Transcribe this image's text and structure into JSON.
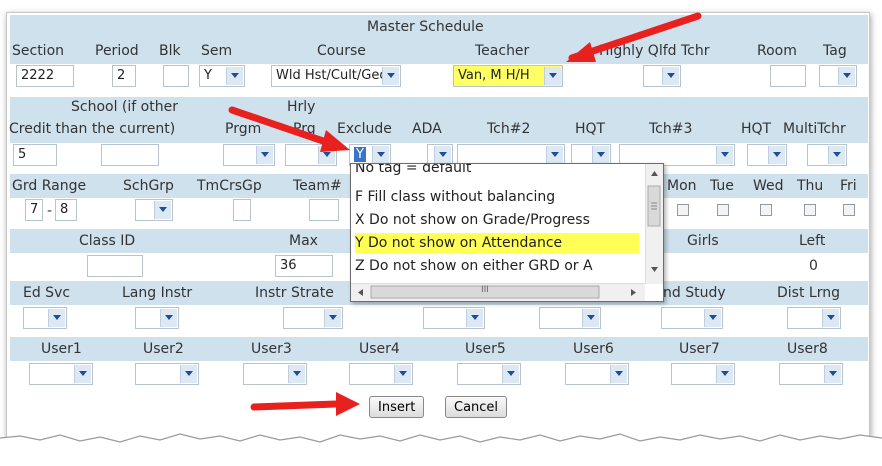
{
  "title": "Master Schedule",
  "row1": {
    "labels": [
      "Section",
      "Period",
      "Blk",
      "Sem",
      "Course",
      "Teacher",
      "Highly Qlfd Tchr",
      "Room",
      "Tag"
    ],
    "section": "2222",
    "period": "2",
    "sem": "Y",
    "course": "Wld Hst/Cult/Geo",
    "teacher": "Van, M  H/H"
  },
  "row2": {
    "school_top": "School (if other",
    "credit_line": "Credit than the current)",
    "prgm": "Prgm",
    "hrly_top": "Hrly",
    "hrly_bottom": "Prg",
    "exclude": "Exclude",
    "ada": "ADA",
    "tch2": "Tch#2",
    "hqt": "HQT",
    "tch3": "Tch#3",
    "hqt2": "HQT",
    "multitchr": "MultiTchr",
    "credit": "5",
    "exclude_value": "Y"
  },
  "row3": {
    "grd_range": "Grd Range",
    "schgrp": "SchGrp",
    "tmcrsgp": "TmCrsGp",
    "team": "Team#",
    "days": [
      "Mon",
      "Tue",
      "Wed",
      "Thu",
      "Fri"
    ],
    "grd_from": "7",
    "grd_sep": "-",
    "grd_to": "8"
  },
  "row4": {
    "class_id": "Class ID",
    "max": "Max",
    "girls": "Girls",
    "left": "Left",
    "max_value": "36",
    "left_value": "0"
  },
  "row5": {
    "ed_svc": "Ed Svc",
    "lang_instr": "Lang Instr",
    "instr_strat": "Instr Strate",
    "ind_study": "nd Study",
    "dist_lrng": "Dist Lrng"
  },
  "row6": {
    "users": [
      "User1",
      "User2",
      "User3",
      "User4",
      "User5",
      "User6",
      "User7",
      "User8"
    ]
  },
  "buttons": {
    "insert": "Insert",
    "cancel": "Cancel"
  },
  "dropdown": {
    "options": [
      "No tag = default",
      "F Fill class without balancing",
      "X Do not show on Grade/Progress",
      "Y Do not show on Attendance",
      "Z Do not show on either GRD or A"
    ],
    "selected_index": 3,
    "scroll_mark": "III"
  },
  "colors": {
    "band": "#cfe1ec",
    "highlight": "#ffff66",
    "arrow": "#e8211f"
  }
}
